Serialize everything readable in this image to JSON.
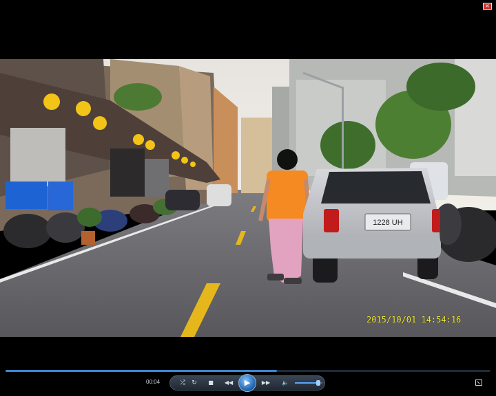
{
  "player": {
    "timestamp_overlay": "2015/10/01 14:54:16",
    "elapsed_time": "00:04",
    "progress_fraction": 0.56,
    "volume_fraction": 0.85,
    "plate_text": "1228 UH",
    "close_glyph": "×"
  },
  "icons": {
    "close": "close-icon",
    "repeat": "repeat-icon",
    "stop": "stop-icon",
    "rewind": "rewind-icon",
    "play": "play-icon",
    "forward": "fast-forward-icon",
    "volume": "volume-icon",
    "fullscreen": "fullscreen-icon",
    "glyphs": {
      "shuffle": "⤮",
      "repeat": "↻",
      "stop": "■",
      "rewind": "◀◀",
      "play": "▶",
      "forward": "▶▶",
      "volume": "🔈"
    }
  },
  "colors": {
    "accent": "#3f86d0",
    "timestamp": "#f0ea3a"
  }
}
